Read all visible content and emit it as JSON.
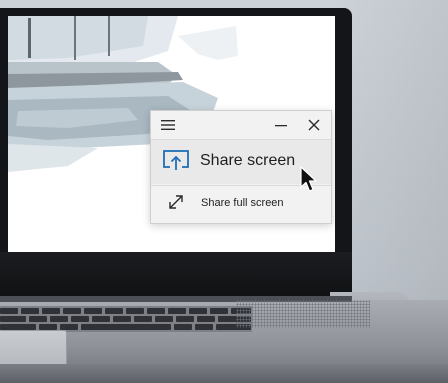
{
  "window": {
    "menu_icon": "hamburger-menu-icon",
    "minimize_icon": "minimize-icon",
    "close_icon": "close-icon",
    "items": [
      {
        "label": "Share screen",
        "icon": "share-screen-icon"
      },
      {
        "label": "Share full screen",
        "icon": "expand-arrows-icon"
      }
    ]
  },
  "colors": {
    "accent": "#1f6fb6",
    "panel_background": "#f2f2f2",
    "highlight": "#e9e9e9"
  }
}
